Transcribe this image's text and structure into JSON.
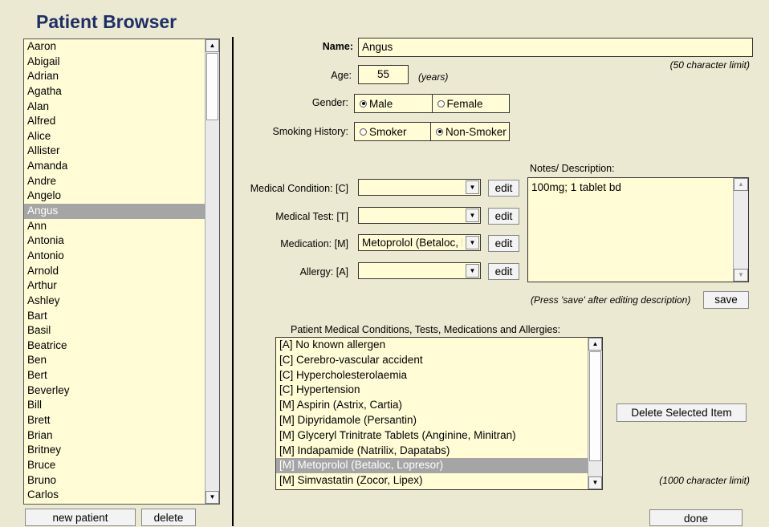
{
  "title": "Patient Browser",
  "patients": [
    "Aaron",
    "Abigail",
    "Adrian",
    "Agatha",
    "Alan",
    "Alfred",
    "Alice",
    "Allister",
    "Amanda",
    "Andre",
    "Angelo",
    "Angus",
    "Ann",
    "Antonia",
    "Antonio",
    "Arnold",
    "Arthur",
    "Ashley",
    "Bart",
    "Basil",
    "Beatrice",
    "Ben",
    "Bert",
    "Beverley",
    "Bill",
    "Brett",
    "Brian",
    "Britney",
    "Bruce",
    "Bruno",
    "Carlos"
  ],
  "selected_patient": "Angus",
  "buttons": {
    "new_patient": "new patient",
    "delete": "delete",
    "edit": "edit",
    "save": "save",
    "delete_selected": "Delete Selected Item",
    "done": "done"
  },
  "form": {
    "name_label": "Name:",
    "name_value": "Angus",
    "name_limit": "(50 character limit)",
    "age_label": "Age:",
    "age_value": "55",
    "age_unit": "(years)",
    "gender_label": "Gender:",
    "gender_options": [
      "Male",
      "Female"
    ],
    "gender_selected": "Male",
    "smoking_label": "Smoking History:",
    "smoking_options": [
      "Smoker",
      "Non-Smoker"
    ],
    "smoking_selected": "Non-Smoker",
    "condition_label": "Medical Condition: [C]",
    "condition_value": "",
    "test_label": "Medical Test: [T]",
    "test_value": "",
    "medication_label": "Medication: [M]",
    "medication_value": "Metoprolol (Betaloc, Lopresor)",
    "allergy_label": "Allergy: [A]",
    "allergy_value": "",
    "notes_label": "Notes/ Description:",
    "notes_value": "100mg; 1 tablet bd",
    "save_hint": "(Press 'save' after editing description)",
    "items_label": "Patient Medical Conditions, Tests, Medications and Allergies:",
    "items_limit": "(1000 character limit)"
  },
  "patient_items": [
    "[A] No known allergen",
    "[C] Cerebro-vascular accident",
    "[C] Hypercholesterolaemia",
    "[C] Hypertension",
    "[M] Aspirin (Astrix, Cartia)",
    "[M] Dipyridamole (Persantin)",
    "[M] Glyceryl Trinitrate Tablets (Anginine, Minitran)",
    "[M] Indapamide (Natrilix, Dapatabs)",
    "[M] Metoprolol (Betaloc, Lopresor)",
    "[M] Simvastatin (Zocor, Lipex)"
  ],
  "selected_item": "[M] Metoprolol (Betaloc, Lopresor)"
}
